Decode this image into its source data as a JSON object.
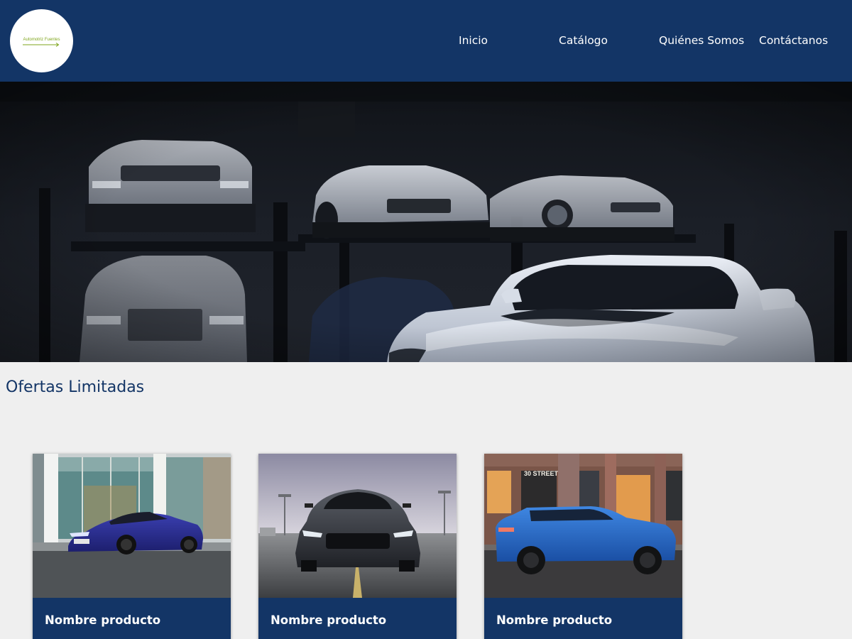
{
  "header": {
    "logo_text": "Automotriz Fuentes",
    "nav": [
      {
        "label": "Inicio"
      },
      {
        "label": "Catálogo"
      },
      {
        "label": "Quiénes Somos"
      },
      {
        "label": "Contáctanos"
      }
    ]
  },
  "hero": {
    "image": "dark garage with white sports cars on lifts"
  },
  "offers": {
    "title": "Ofertas Limitadas",
    "products": [
      {
        "name": "Nombre producto",
        "image": "blue coupe in front of glass building"
      },
      {
        "name": "Nombre producto",
        "image": "dark grey muscle car front view"
      },
      {
        "name": "Nombre producto",
        "image": "blue SUV in front of brick storefront",
        "sign": "30 STREET"
      }
    ]
  },
  "colors": {
    "primary": "#133566",
    "background": "#efefef",
    "logo_accent": "#7fa51c"
  }
}
